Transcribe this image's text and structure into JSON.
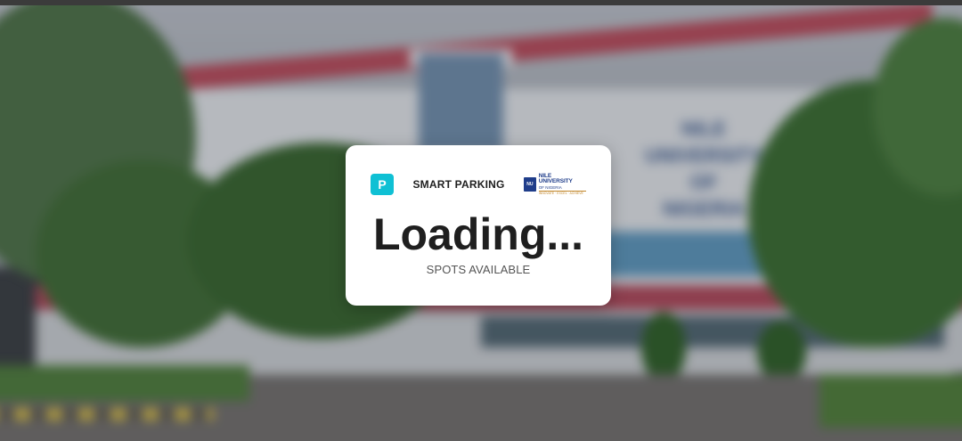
{
  "background": {
    "facade_text": [
      "NILE",
      "UNIVERSITY",
      "OF",
      "NIGERIA"
    ]
  },
  "card": {
    "badge_letter": "P",
    "title": "SMART PARKING",
    "logo": {
      "line1": "NILE UNIVERSITY",
      "line2": "OF NIGERIA",
      "line3": "INNOVATE · EXCEL · ACHIEVE"
    },
    "count_text": "Loading...",
    "spots_label": "SPOTS AVAILABLE"
  },
  "colors": {
    "badge": "#0fc0d4",
    "logo_blue": "#1f3d8a",
    "text_dark": "#1f1f1f"
  }
}
